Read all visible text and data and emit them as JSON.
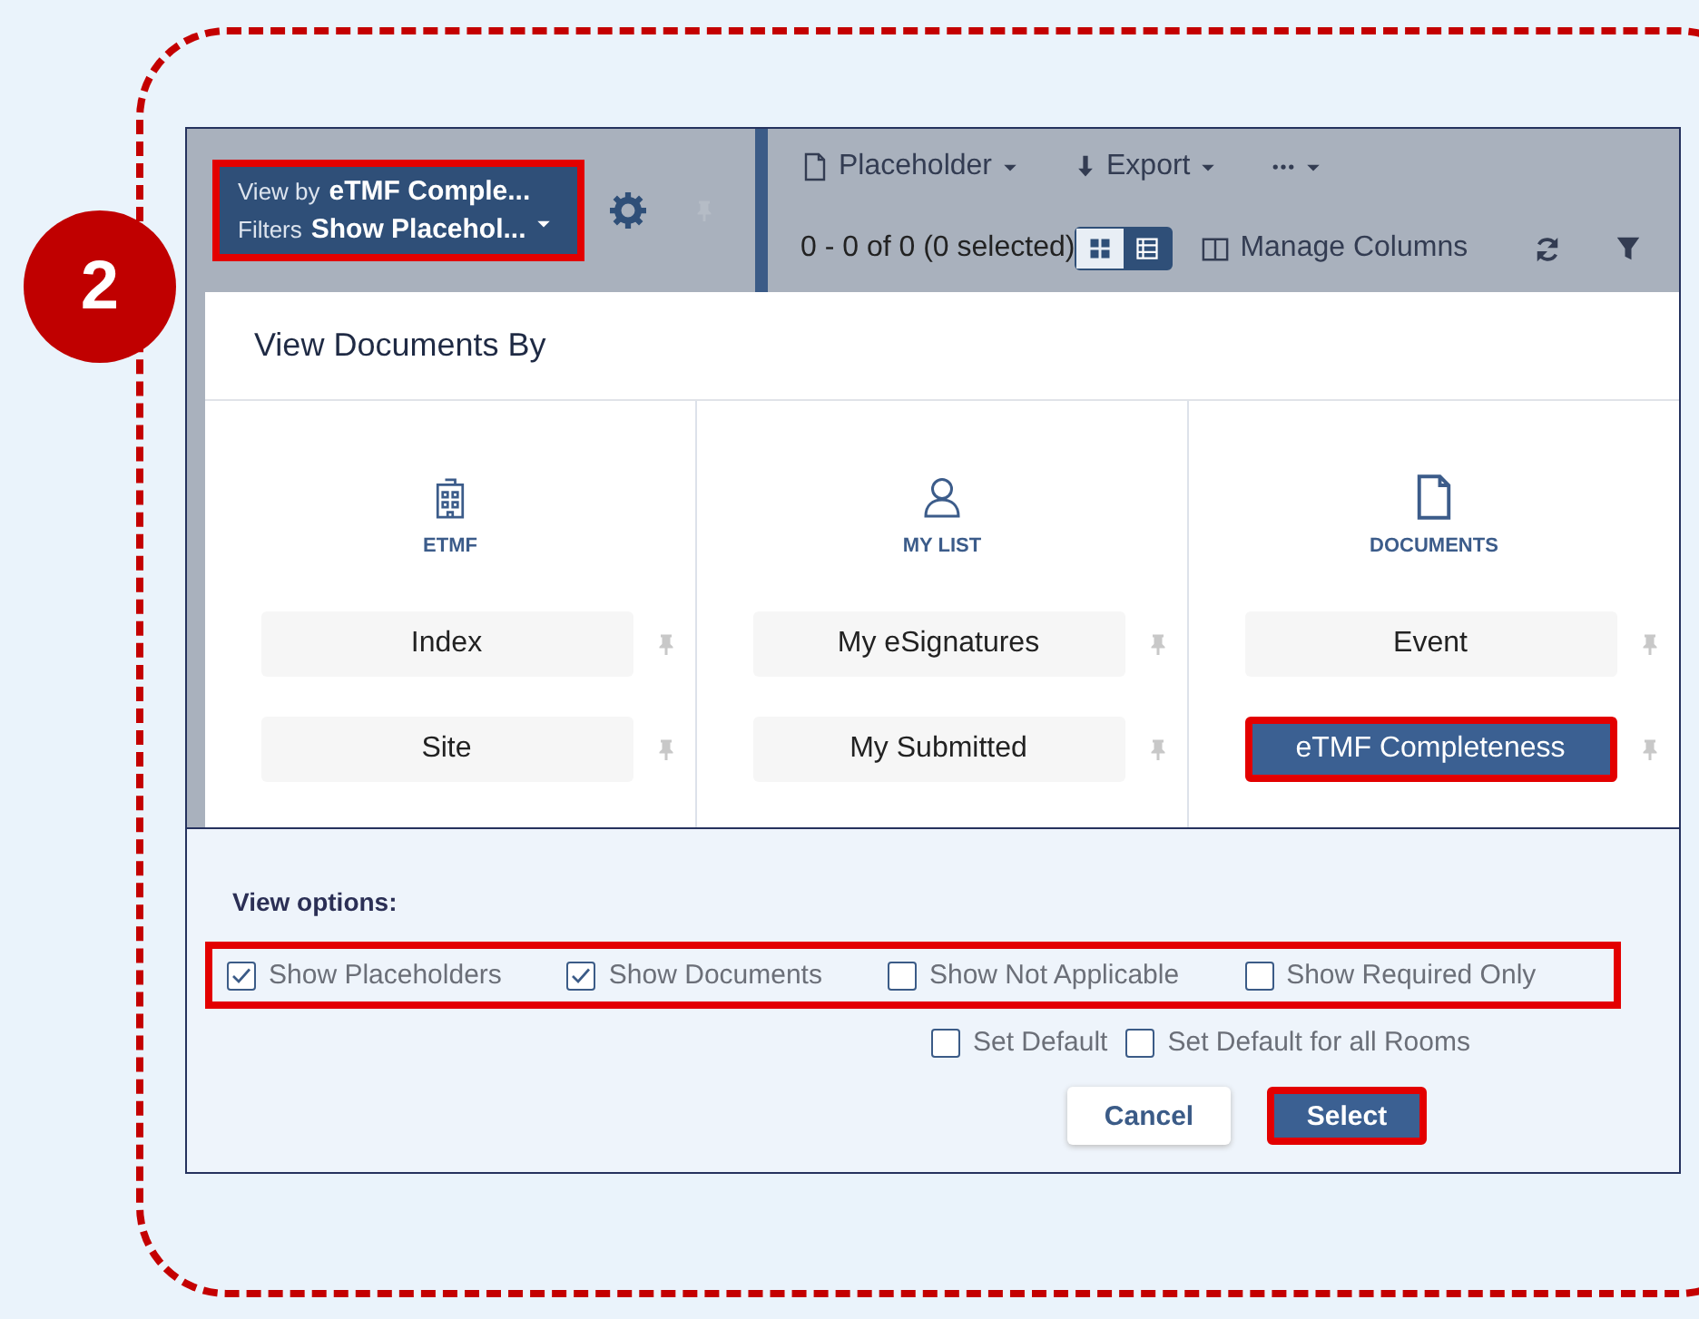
{
  "step_badge": "2",
  "toolbar": {
    "view_by_label": "View by",
    "view_by_value": "eTMF Comple...",
    "filters_label": "Filters",
    "filters_value": "Show Placehol...",
    "highlighted": true,
    "actions": [
      {
        "kind": "document",
        "label": "Placeholder"
      },
      {
        "kind": "download",
        "label": "Export"
      },
      {
        "kind": "more"
      }
    ],
    "record_count": "0 - 0 of 0 (0 selected)",
    "view_modes": [
      {
        "kind": "grid",
        "selected": false
      },
      {
        "kind": "list",
        "selected": true
      }
    ],
    "manage_columns": "Manage Columns"
  },
  "dialog": {
    "title": "View Documents By",
    "columns": [
      {
        "kind": "building",
        "heading": "ETMF",
        "items": [
          {
            "label": "Index",
            "selected": false,
            "highlighted": false
          },
          {
            "label": "Site",
            "selected": false,
            "highlighted": false
          }
        ]
      },
      {
        "kind": "person",
        "heading": "MY LIST",
        "items": [
          {
            "label": "My eSignatures",
            "selected": false,
            "highlighted": false
          },
          {
            "label": "My Submitted",
            "selected": false,
            "highlighted": false
          }
        ]
      },
      {
        "kind": "document",
        "heading": "DOCUMENTS",
        "items": [
          {
            "label": "Event",
            "selected": false,
            "highlighted": false
          },
          {
            "label": "eTMF Completeness",
            "selected": true,
            "highlighted": true
          }
        ]
      }
    ]
  },
  "view_options": {
    "title": "View options:",
    "highlighted": true,
    "options": [
      {
        "label": "Show Placeholders",
        "checked": true
      },
      {
        "label": "Show Documents",
        "checked": true
      },
      {
        "label": "Show Not Applicable",
        "checked": false
      },
      {
        "label": "Show Required Only",
        "checked": false
      }
    ],
    "defaults": [
      {
        "label": "Set Default",
        "checked": false
      },
      {
        "label": "Set Default for all Rooms",
        "checked": false
      }
    ],
    "buttons": [
      {
        "label": "Cancel",
        "kind": "secondary",
        "highlighted": false
      },
      {
        "label": "Select",
        "kind": "primary",
        "highlighted": true
      }
    ]
  }
}
